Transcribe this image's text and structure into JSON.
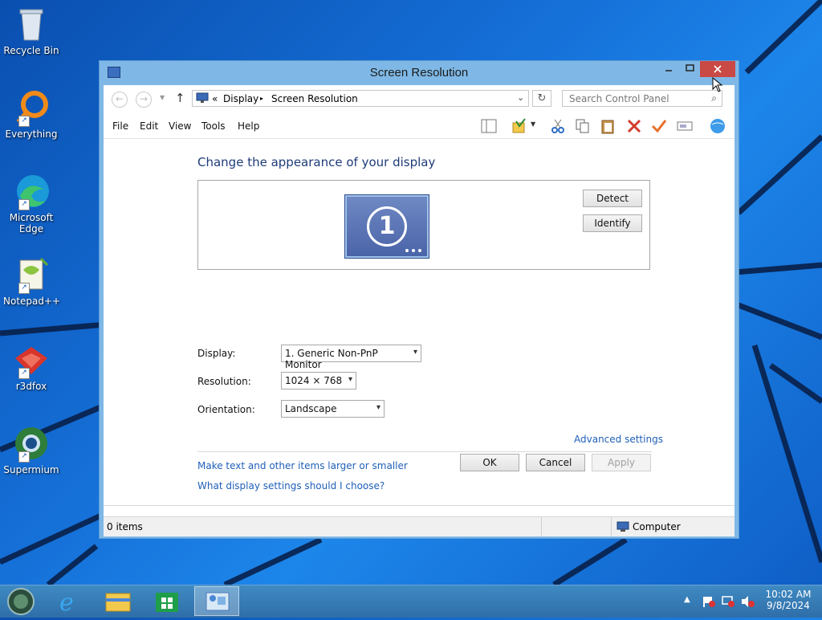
{
  "desktop": {
    "icons": [
      {
        "label": "Recycle Bin",
        "icon": "recycle-bin-icon"
      },
      {
        "label": "Everything",
        "icon": "everything-search-icon"
      },
      {
        "label": "Microsoft Edge",
        "icon": "edge-icon"
      },
      {
        "label": "Notepad++",
        "icon": "notepad-plus-plus-icon"
      },
      {
        "label": "r3dfox",
        "icon": "r3dfox-icon"
      },
      {
        "label": "Supermium",
        "icon": "supermium-icon"
      }
    ]
  },
  "window": {
    "title": "Screen Resolution",
    "address": {
      "prefix": "«",
      "crumbs": [
        "Display",
        "Screen Resolution"
      ],
      "separator": "▸"
    },
    "search_placeholder": "Search Control Panel",
    "menu": [
      "File",
      "Edit",
      "View",
      "Tools",
      "Help"
    ],
    "heading": "Change the appearance of your display",
    "monitor_number": "1",
    "detect_label": "Detect",
    "identify_label": "Identify",
    "fields": {
      "display": {
        "label": "Display:",
        "value": "1. Generic Non-PnP Monitor"
      },
      "resolution": {
        "label": "Resolution:",
        "value": "1024 × 768"
      },
      "orientation": {
        "label": "Orientation:",
        "value": "Landscape"
      }
    },
    "advanced_link": "Advanced settings",
    "links": [
      "Make text and other items larger or smaller",
      "What display settings should I choose?"
    ],
    "buttons": {
      "ok": "OK",
      "cancel": "Cancel",
      "apply": "Apply"
    },
    "status": {
      "items": "0 items",
      "location": "Computer"
    }
  },
  "taskbar": {
    "apps": [
      "start-orb-icon",
      "internet-explorer-icon",
      "file-explorer-icon",
      "store-icon",
      "control-panel-icon"
    ],
    "time": "10:02 AM",
    "date": "9/8/2024"
  }
}
